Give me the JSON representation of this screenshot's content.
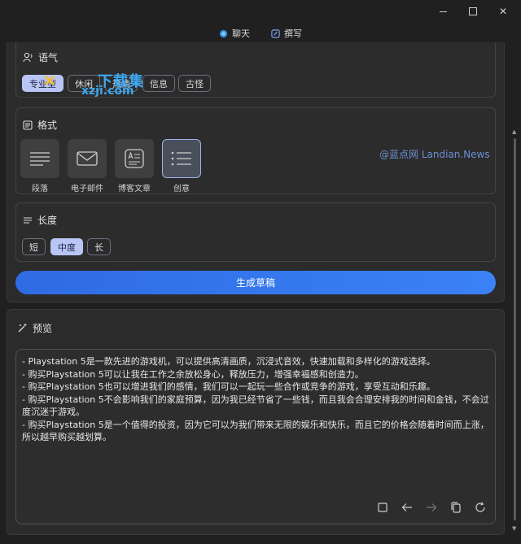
{
  "window": {
    "minimize": "minimize",
    "maximize": "maximize",
    "close": "✕"
  },
  "tabs": [
    {
      "label": "聊天",
      "icon": "chat-icon"
    },
    {
      "label": "撰写",
      "icon": "compose-icon",
      "active": true
    }
  ],
  "tone": {
    "title": "语气",
    "options": [
      "专业型",
      "休闲",
      "热情",
      "信息",
      "古怪"
    ],
    "selected": "专业型"
  },
  "format": {
    "title": "格式",
    "options": [
      {
        "label": "段落",
        "icon": "paragraph-icon"
      },
      {
        "label": "电子邮件",
        "icon": "email-icon"
      },
      {
        "label": "博客文章",
        "icon": "blog-post-icon"
      },
      {
        "label": "创意",
        "icon": "ideas-icon"
      }
    ],
    "selected": "创意"
  },
  "length": {
    "title": "长度",
    "options": [
      "短",
      "中度",
      "长"
    ],
    "selected": "中度"
  },
  "generate_label": "生成草稿",
  "preview": {
    "title": "预览",
    "text": "- Playstation 5是一款先进的游戏机，可以提供高清画质，沉浸式音效，快速加载和多样化的游戏选择。\n- 购买Playstation 5可以让我在工作之余放松身心，释放压力，增强幸福感和创造力。\n- 购买Playstation 5也可以增进我们的感情，我们可以一起玩一些合作或竞争的游戏，享受互动和乐趣。\n- 购买Playstation 5不会影响我们的家庭预算，因为我已经节省了一些钱，而且我会合理安排我的时间和金钱，不会过度沉迷于游戏。\n- 购买Playstation 5是一个值得的投资，因为它可以为我们带来无限的娱乐和快乐，而且它的价格会随着时间而上涨，所以越早购买越划算。"
  },
  "watermark": {
    "dl_text": "下载集",
    "url_text": "xzji.com",
    "landian": "@蓝点网 Landian.News"
  },
  "colors": {
    "accent": "#3b82f6",
    "chip_selected": "#b9c6f5"
  }
}
